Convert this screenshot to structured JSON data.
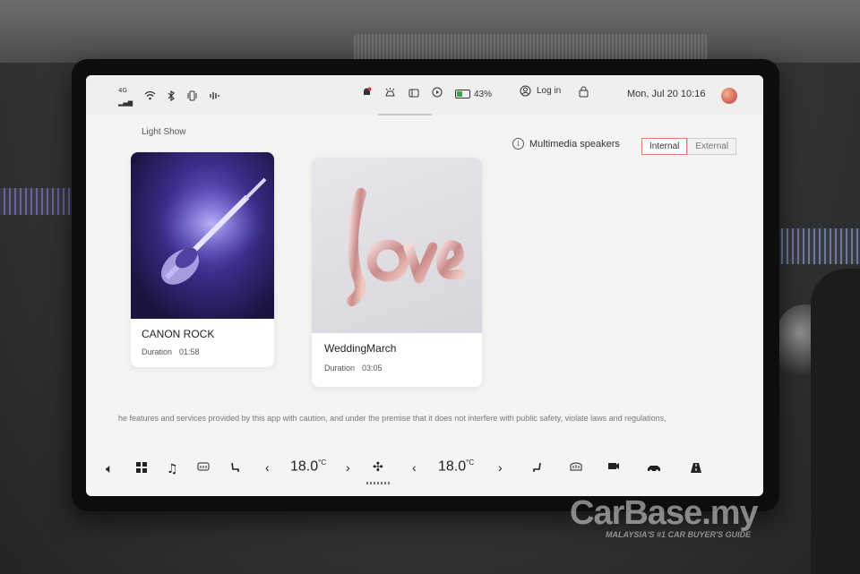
{
  "status_bar": {
    "signal": "4G",
    "battery_percent": "43%",
    "login_label": "Log in",
    "datetime": "Mon, Jul 20 10:16"
  },
  "page": {
    "section_title": "Light Show",
    "speakers_label": "Multimedia speakers",
    "speaker_options": [
      "Internal",
      "External"
    ],
    "speaker_selected": "Internal"
  },
  "tracks": [
    {
      "title": "CANON ROCK",
      "duration_label": "Duration",
      "duration": "01:58"
    },
    {
      "title": "WeddingMarch",
      "duration_label": "Duration",
      "duration": "03:05"
    }
  ],
  "disclaimer": "he features and services provided by this app with caution, and under the premise that it does not interfere with public safety, violate laws and regulations,",
  "climate": {
    "left_temp": "18.0",
    "right_temp": "18.0",
    "unit": "°C"
  },
  "watermark": {
    "brand": "CarBase.my",
    "tagline": "MALAYSIA'S #1 CAR BUYER'S GUIDE"
  },
  "colors": {
    "accent": "#e08070",
    "battery": "#3aa34a"
  }
}
